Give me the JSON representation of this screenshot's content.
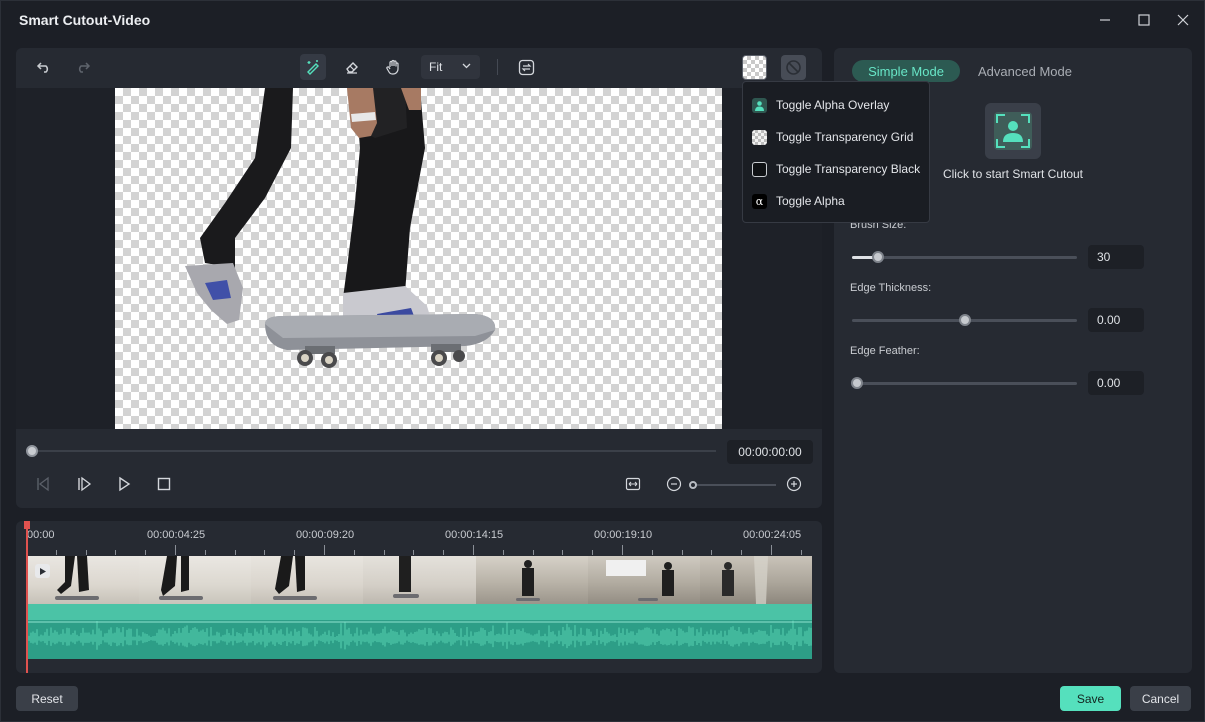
{
  "window": {
    "title": "Smart Cutout-Video"
  },
  "preview_toolbar": {
    "fit_select": "Fit"
  },
  "view_menu": {
    "items": [
      {
        "label": "Toggle Alpha Overlay",
        "icon": "person-overlay-icon"
      },
      {
        "label": "Toggle Transparency Grid",
        "icon": "checker-grid-icon"
      },
      {
        "label": "Toggle Transparency Black",
        "icon": "black-square-icon"
      },
      {
        "label": "Toggle Alpha",
        "icon": "alpha-icon"
      }
    ]
  },
  "playback": {
    "timecode": "00:00:00:00",
    "progress": 0
  },
  "right_panel": {
    "tabs": [
      {
        "label": "Simple Mode",
        "active": true
      },
      {
        "label": "Advanced Mode",
        "active": false
      }
    ],
    "cutout_label": "Click to start Smart Cutout",
    "brush_size": {
      "label": "Brush Size:",
      "value": "30",
      "fraction": 0.12
    },
    "edge_thickness": {
      "label": "Edge Thickness:",
      "value": "0.00",
      "fraction": 0.5
    },
    "edge_feather": {
      "label": "Edge Feather:",
      "value": "0.00",
      "fraction": 0.0
    }
  },
  "timeline": {
    "ruler_labels": [
      "00:00",
      "00:00:04:25",
      "00:00:09:20",
      "00:00:14:15",
      "00:00:19:10",
      "00:00:24:05"
    ]
  },
  "footer": {
    "reset": "Reset",
    "save": "Save",
    "cancel": "Cancel"
  },
  "colors": {
    "accent": "#55e0bd",
    "panel": "#262a32",
    "background": "#1c1f26",
    "audio_wave": "#4bc3a6"
  }
}
